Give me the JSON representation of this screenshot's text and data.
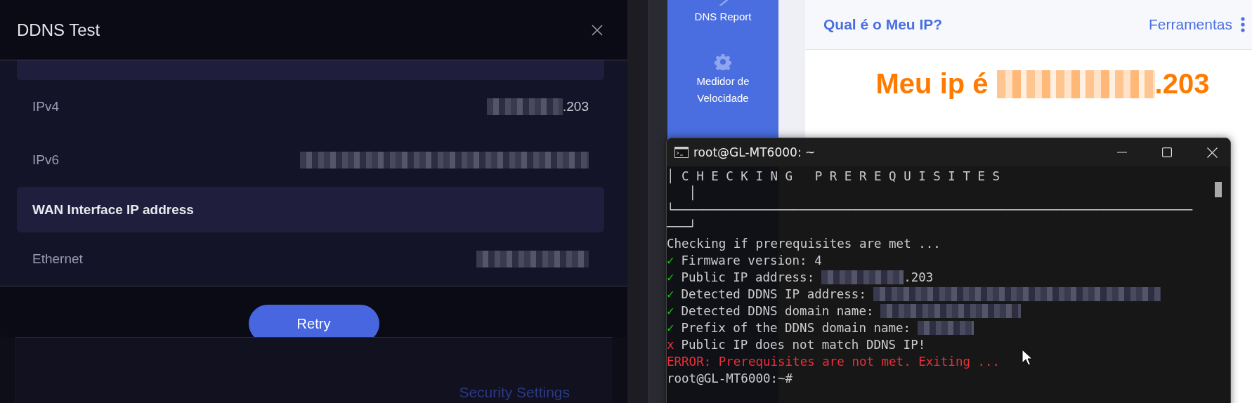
{
  "dialog": {
    "title": "DDNS Test",
    "items": [
      {
        "kind": "section"
      },
      {
        "kind": "row",
        "label": "IPv4",
        "redacted": true,
        "value": ".203"
      },
      {
        "kind": "row",
        "label": "IPv6",
        "redacted": true
      },
      {
        "kind": "section",
        "label": "WAN Interface IP address"
      },
      {
        "kind": "row",
        "label": "Ethernet",
        "redacted": true
      }
    ],
    "button": "Retry"
  },
  "background_page": {
    "link": "Security Settings"
  },
  "website": {
    "sidebar": [
      {
        "label": "DNS Report"
      },
      {
        "label": "Medidor de Velocidade"
      }
    ],
    "brand": "Qual é o Meu IP?",
    "menu": "Ferramentas",
    "headline": {
      "before": "Meu ip é",
      "redacted": true,
      "after": ".203"
    }
  },
  "terminal": {
    "title": "root@GL-MT6000: ~",
    "lines": [
      {
        "kind": "plain",
        "text": "│ C H E C K I N G   P R E R E Q U I S I T E S"
      },
      {
        "kind": "plain",
        "text": "   │"
      },
      {
        "kind": "plain",
        "text": "└──────────────────────────────────────────────────────────────────────"
      },
      {
        "kind": "plain",
        "text": "───┘"
      },
      {
        "kind": "plain",
        "text": "Checking if prerequisites are met ..."
      },
      {
        "kind": "ok",
        "mark": "✓",
        "text": "Firmware version: 4"
      },
      {
        "kind": "ok",
        "mark": "✓",
        "text": "Public IP address:",
        "redacted": true,
        "tail": ".203"
      },
      {
        "kind": "ok",
        "mark": "✓",
        "text": "Detected DDNS IP address:",
        "redacted": true
      },
      {
        "kind": "ok",
        "mark": "✓",
        "text": "Detected DDNS domain name:",
        "redacted": true
      },
      {
        "kind": "ok",
        "mark": "✓",
        "text": "Prefix of the DDNS domain name:",
        "redacted": true
      },
      {
        "kind": "fail",
        "mark": "x",
        "text": "Public IP does not match DDNS IP!"
      },
      {
        "kind": "error",
        "text": "ERROR: Prerequisites are not met. Exiting ..."
      },
      {
        "kind": "plain",
        "text": "root@GL-MT6000:~#"
      }
    ]
  }
}
